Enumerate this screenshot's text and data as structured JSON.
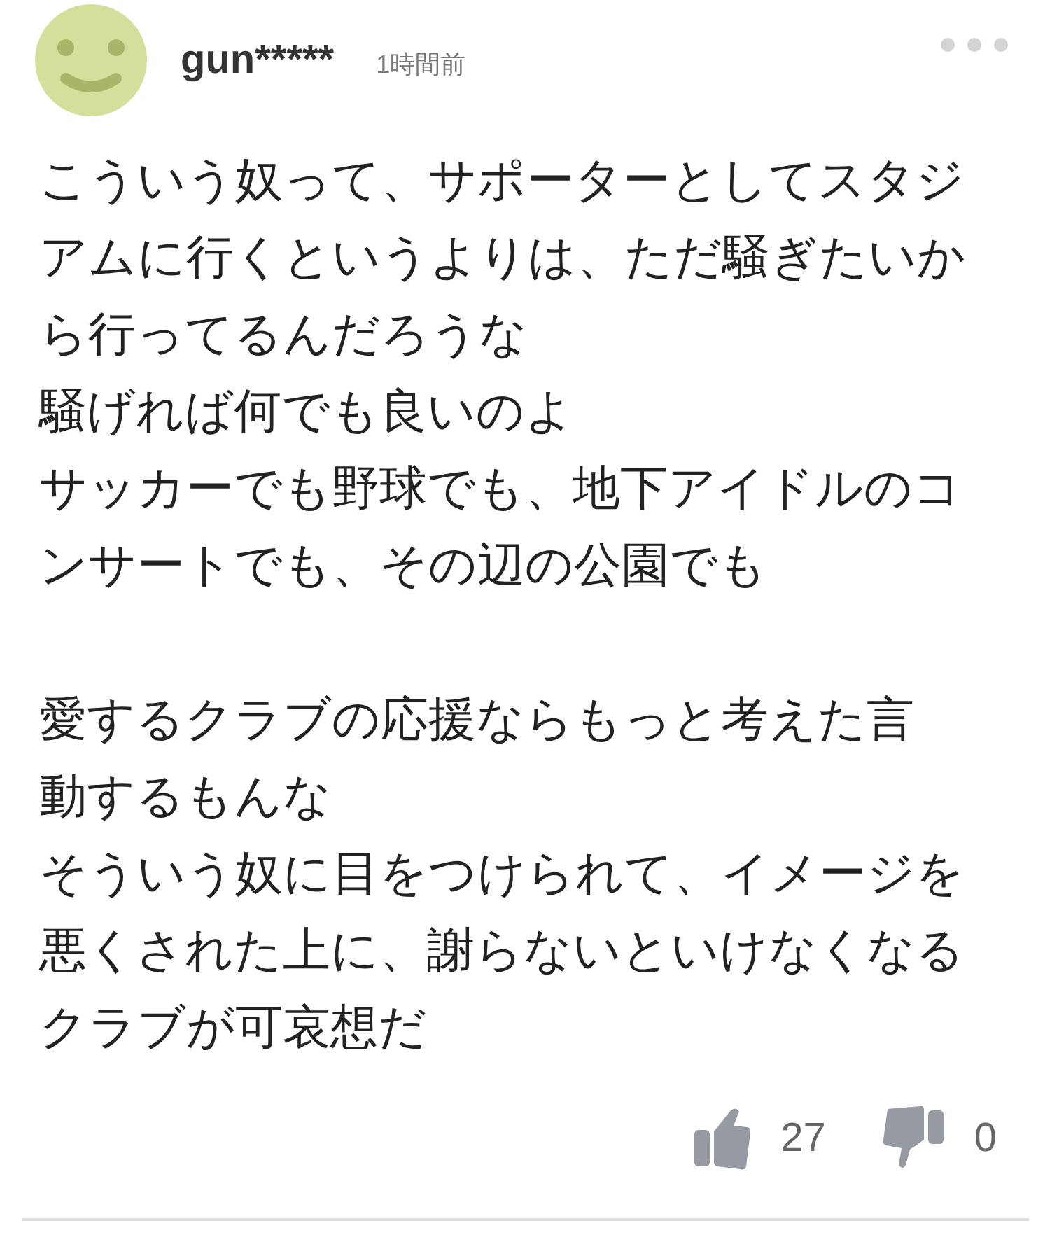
{
  "comment": {
    "user": "gun*****",
    "time": "1時間前",
    "paragraphs": [
      [
        "こういう奴って、サポーターとしてスタジ",
        "アムに行くというよりは、ただ騒ぎたいか",
        "ら行ってるんだろうな",
        "騒げれば何でも良いのよ",
        "サッカーでも野球でも、地下アイドルのコ",
        "ンサートでも、その辺の公園でも"
      ],
      [
        "愛するクラブの応援ならもっと考えた言",
        "動するもんな",
        "そういう奴に目をつけられて、イメージを",
        "悪くされた上に、謝らないといけなくなる",
        "クラブが可哀想だ"
      ]
    ],
    "likes": "27",
    "dislikes": "0"
  }
}
